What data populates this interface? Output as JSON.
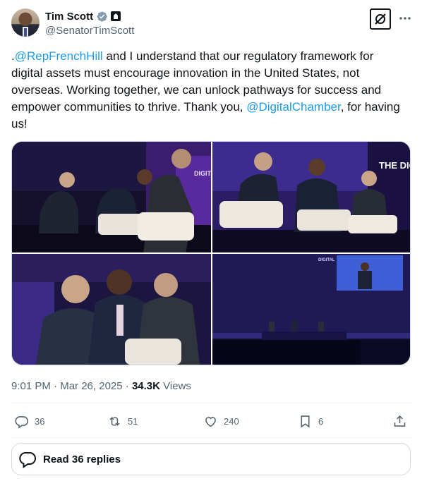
{
  "author": {
    "display_name": "Tim Scott",
    "handle": "@SenatorTimScott"
  },
  "tweet": {
    "segments": [
      {
        "text": ".",
        "type": "text"
      },
      {
        "text": "@RepFrenchHill",
        "type": "mention"
      },
      {
        "text": " and I understand that our regulatory framework for digital assets must encourage innovation in the United States, not overseas. Working together, we can unlock pathways for success and empower communities to thrive. Thank you, ",
        "type": "text"
      },
      {
        "text": "@DigitalChamber",
        "type": "mention"
      },
      {
        "text": ", for having us!",
        "type": "text"
      }
    ]
  },
  "media": {
    "photos": [
      {
        "stage_text": "DIGITAL CHAMBER"
      },
      {
        "stage_text": "THE DIGIT"
      },
      {
        "stage_text": ""
      },
      {
        "stage_text": "DIGITAL"
      }
    ]
  },
  "meta": {
    "time": "9:01 PM",
    "separator": "·",
    "date": "Mar 26, 2025",
    "views_count": "34.3K",
    "views_label": "Views"
  },
  "actions": {
    "replies": "36",
    "reposts": "51",
    "likes": "240",
    "bookmarks": "6"
  },
  "read_replies": {
    "label": "Read 36 replies"
  },
  "colors": {
    "accent": "#1d9bf0",
    "text": "#0f1419",
    "secondary": "#536471",
    "border": "#cfd9de"
  },
  "icons": {
    "verified": "verified-badge-icon",
    "government": "government-label-icon",
    "grok": "grok-icon",
    "more": "more-icon",
    "reply": "reply-icon",
    "repost": "repost-icon",
    "like": "heart-icon",
    "bookmark": "bookmark-icon",
    "share": "share-icon",
    "replies": "speech-bubble-icon"
  }
}
